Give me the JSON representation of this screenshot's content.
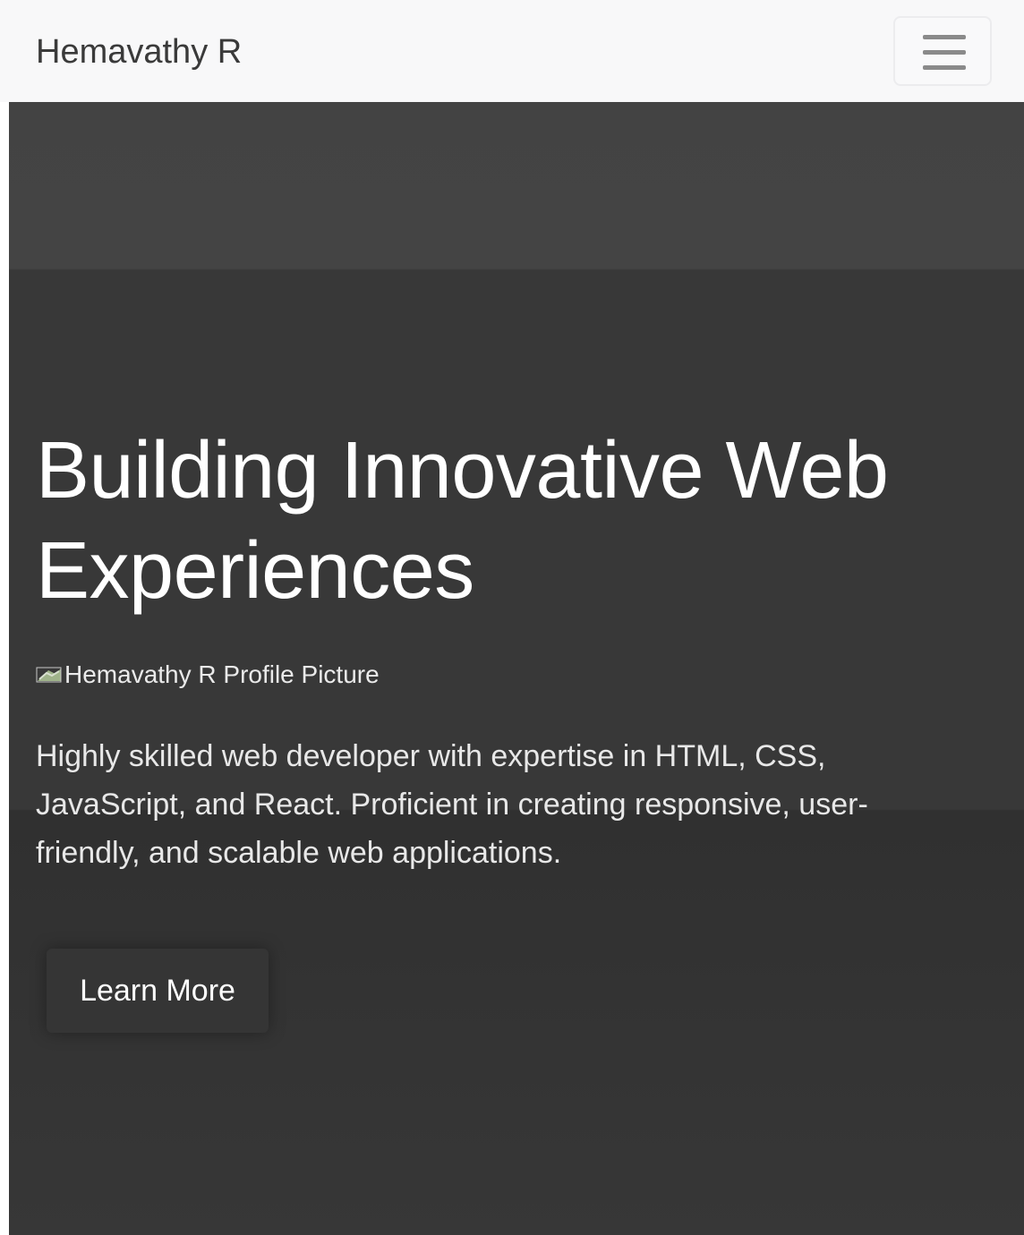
{
  "navbar": {
    "brand": "Hemavathy R",
    "menu_icon": "hamburger-menu-icon"
  },
  "hero": {
    "title": "Building Innovative Web Experiences",
    "profile_image_alt": "Hemavathy R Profile Picture",
    "profile_image_icon": "broken-image-icon",
    "description": "Highly skilled web developer with expertise in HTML, CSS, JavaScript, and React. Proficient in creating responsive, user-friendly, and scalable web applications.",
    "cta_label": "Learn More"
  },
  "colors": {
    "navbar_bg": "#f8f8f9",
    "hero_bg": "#383838",
    "hero_text": "#ffffff",
    "button_bg": "#353535"
  }
}
